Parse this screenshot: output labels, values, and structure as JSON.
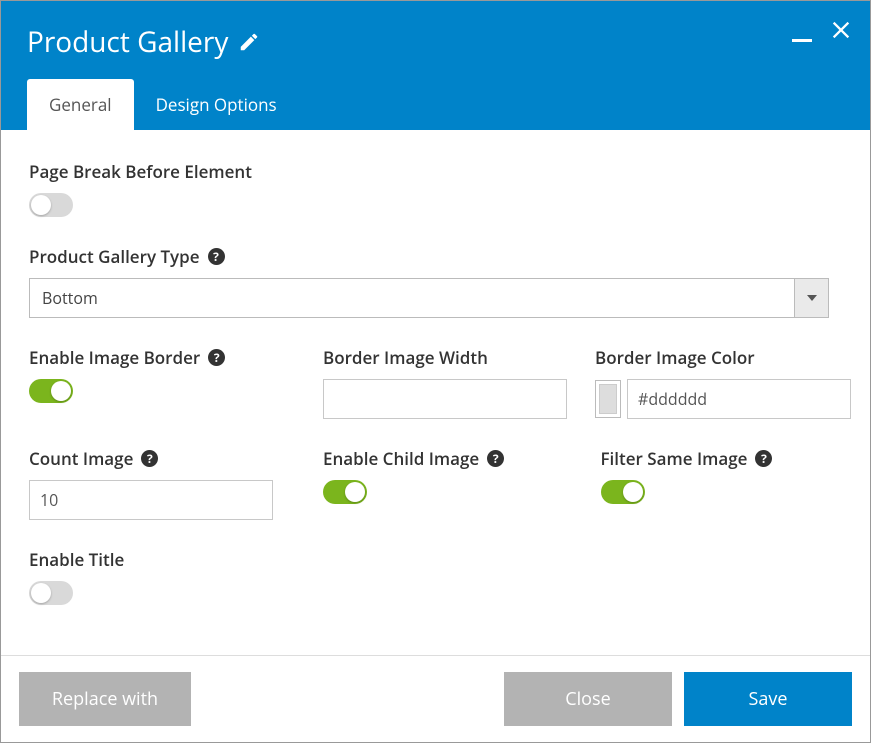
{
  "header": {
    "title": "Product Gallery"
  },
  "tabs": {
    "general": "General",
    "design": "Design Options"
  },
  "fields": {
    "page_break": {
      "label": "Page Break Before Element",
      "value": false
    },
    "gallery_type": {
      "label": "Product Gallery Type",
      "value": "Bottom"
    },
    "enable_border": {
      "label": "Enable Image Border",
      "value": true
    },
    "border_width": {
      "label": "Border Image Width",
      "value": ""
    },
    "border_color": {
      "label": "Border Image Color",
      "value": "#dddddd"
    },
    "count_image": {
      "label": "Count Image",
      "value": "10"
    },
    "enable_child": {
      "label": "Enable Child Image",
      "value": true
    },
    "filter_same": {
      "label": "Filter Same Image",
      "value": true
    },
    "enable_title": {
      "label": "Enable Title",
      "value": false
    }
  },
  "footer": {
    "replace": "Replace with",
    "close": "Close",
    "save": "Save"
  },
  "help_glyph": "?"
}
